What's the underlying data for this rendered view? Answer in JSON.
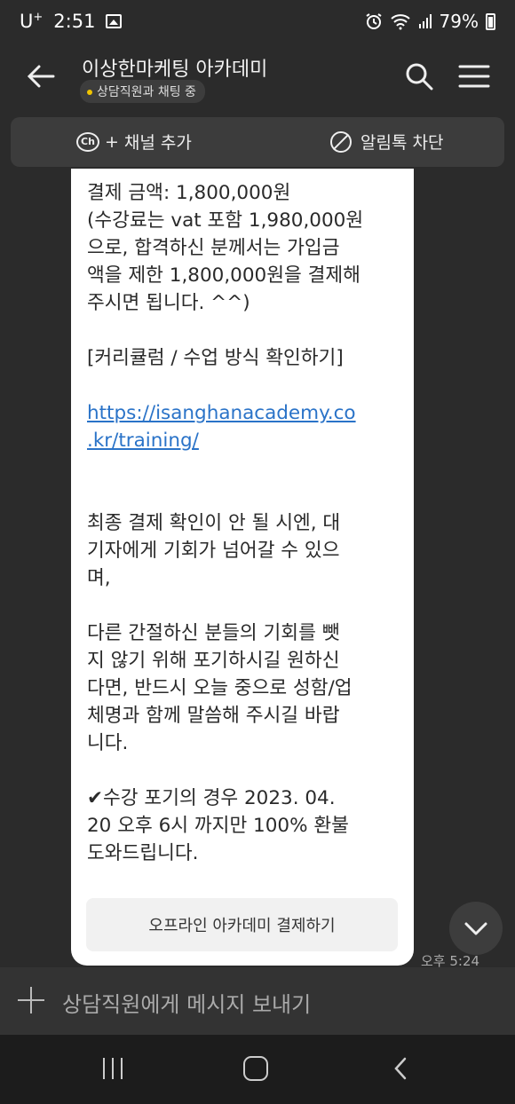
{
  "status_bar": {
    "carrier": "U",
    "carrier_sup": "+",
    "time": "2:51",
    "battery": "79%"
  },
  "header": {
    "title": "이상한마케팅 아카데미",
    "status": "상담직원과 채팅 중"
  },
  "channel_bar": {
    "add_channel": "채널 추가",
    "ch_logo": "Ch",
    "block_alert": "알림톡 차단"
  },
  "message": {
    "lines": [
      "결제 금액: 1,800,000원",
      "(수강료는 vat 포함 1,980,000원",
      "으로, 합격하신 분께서는 가입금",
      "액을 제한 1,800,000원을 결제해",
      "주시면 됩니다. ^^)",
      "",
      "[커리큘럼 / 수업 방식 확인하기]",
      "",
      "https://isanghanacademy.co",
      ".kr/training/",
      "",
      "",
      "최종 결제 확인이 안 될 시엔, 대",
      "기자에게 기회가 넘어갈 수 있으",
      "며,",
      "",
      "다른 간절하신 분들의 기회를 뺏",
      "지 않기 위해 포기하시길 원하신",
      "다면, 반드시 오늘 중으로 성함/업",
      "체명과 함께 말씀해 주시길 바랍",
      "니다.",
      "",
      "✔수강 포기의 경우 2023. 04.",
      "20 오후 6시 까지만 100% 환불",
      "도와드립니다."
    ],
    "button_label": "오프라인 아카데미 결제하기",
    "time": "오후 5:24"
  },
  "input": {
    "placeholder": "상담직원에게 메시지 보내기"
  },
  "icons": {
    "back": "arrow-left-icon",
    "search": "search-icon",
    "menu": "hamburger-menu-icon",
    "scroll": "chevron-down-icon"
  }
}
